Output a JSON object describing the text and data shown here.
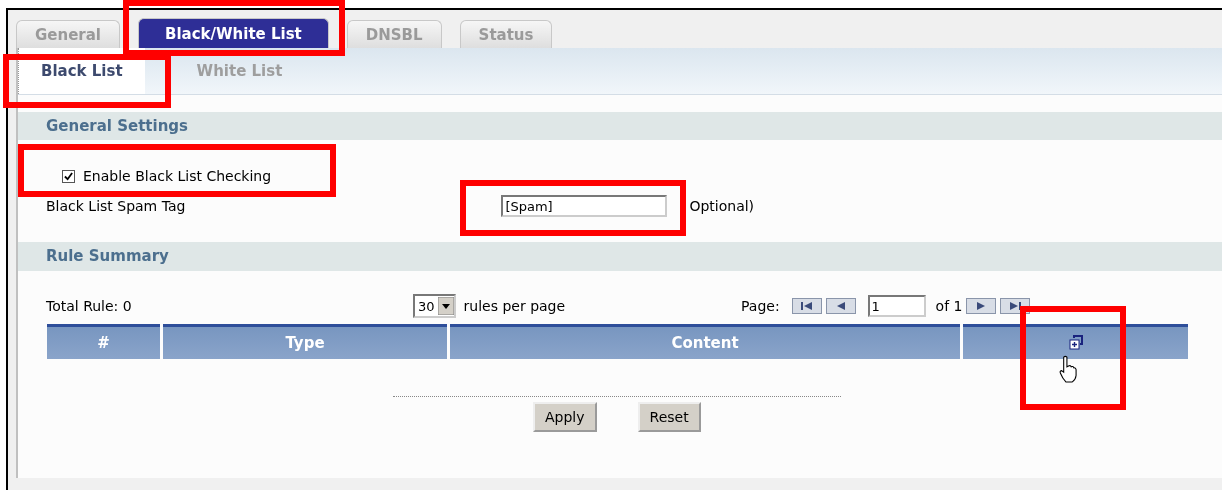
{
  "tabs": [
    {
      "label": "General",
      "selected": false
    },
    {
      "label": "Black/White List",
      "selected": true
    },
    {
      "label": "DNSBL",
      "selected": false
    },
    {
      "label": "Status",
      "selected": false
    }
  ],
  "subtabs": [
    {
      "label": "Black List",
      "selected": true
    },
    {
      "label": "White List",
      "selected": false
    }
  ],
  "general_settings": {
    "title": "General Settings",
    "enable_checkbox": {
      "label": "Enable Black List Checking",
      "checked": true
    },
    "spam_tag": {
      "label": "Black List Spam Tag",
      "value": "[Spam]",
      "note": "Optional)"
    }
  },
  "rule_summary": {
    "title": "Rule Summary",
    "total": "Total Rule: 0",
    "per_page": {
      "value": "30",
      "label": "rules per page"
    },
    "page_label": "Page:",
    "page_value": "1",
    "page_of": "of 1",
    "columns": [
      {
        "label": "#",
        "kind": "text"
      },
      {
        "label": "Type",
        "kind": "text"
      },
      {
        "label": "Content",
        "kind": "text"
      },
      {
        "kind": "add-icon"
      }
    ]
  },
  "buttons": [
    "Apply",
    "Reset"
  ]
}
